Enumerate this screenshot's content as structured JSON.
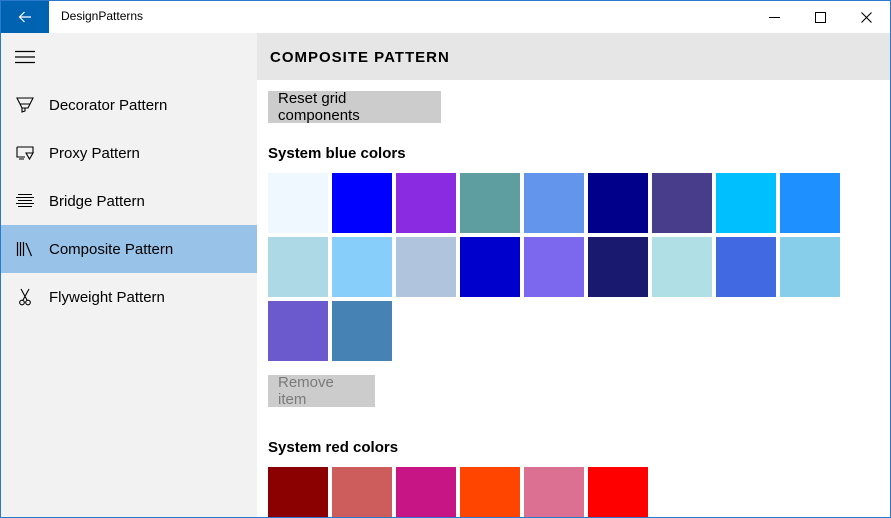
{
  "window": {
    "title": "DesignPatterns",
    "accent": "#0063b1",
    "border": "#2b78d0"
  },
  "icons": {
    "back": "back-arrow-icon",
    "minimize": "minimize-icon",
    "maximize": "maximize-icon",
    "close": "close-icon",
    "menu": "hamburger-menu-icon"
  },
  "sidebar": {
    "background": "#f2f2f2",
    "selected_background": "#99c2e8",
    "items": [
      {
        "label": "Decorator Pattern",
        "icon": "highlighter-icon",
        "selected": false
      },
      {
        "label": "Proxy Pattern",
        "icon": "screen-share-icon",
        "selected": false
      },
      {
        "label": "Bridge Pattern",
        "icon": "align-center-icon",
        "selected": false
      },
      {
        "label": "Composite Pattern",
        "icon": "library-icon",
        "selected": true
      },
      {
        "label": "Flyweight Pattern",
        "icon": "scissors-icon",
        "selected": false
      }
    ]
  },
  "main": {
    "title": "COMPOSITE PATTERN",
    "reset_button": "Reset grid components",
    "remove_button": "Remove item",
    "remove_button_enabled": false,
    "blue_section_title": "System blue colors",
    "red_section_title": "System red colors",
    "blue_colors": [
      "#f0f8ff",
      "#0000ff",
      "#8a2be2",
      "#5f9ea0",
      "#6495ed",
      "#00008b",
      "#483d8b",
      "#00bfff",
      "#1e90ff",
      "#add8e6",
      "#87cefa",
      "#b0c4de",
      "#0000cd",
      "#7b68ee",
      "#191970",
      "#b0e0e6",
      "#4169e1",
      "#87ceeb",
      "#6a5acd",
      "#4682b4"
    ],
    "red_colors": [
      "#8b0000",
      "#cd5c5c",
      "#c71585",
      "#ff4500",
      "#db7093",
      "#ff0000"
    ]
  }
}
